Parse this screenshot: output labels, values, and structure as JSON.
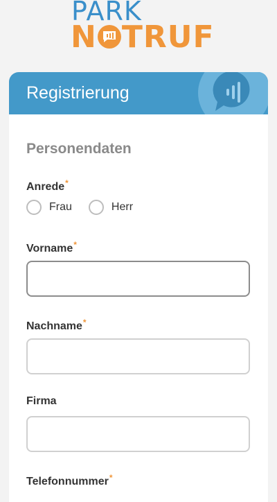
{
  "logo": {
    "line1": "PARK",
    "line2_start": "N",
    "line2_end": "TRUF"
  },
  "header": {
    "title": "Registrierung"
  },
  "section": {
    "title": "Personendaten"
  },
  "form": {
    "salutation": {
      "label": "Anrede",
      "required_mark": "*",
      "options": [
        "Frau",
        "Herr"
      ]
    },
    "first_name": {
      "label": "Vorname",
      "required_mark": "*",
      "value": ""
    },
    "last_name": {
      "label": "Nachname",
      "required_mark": "*",
      "value": ""
    },
    "company": {
      "label": "Firma",
      "value": ""
    },
    "phone": {
      "label": "Telefonnummer",
      "required_mark": "*"
    }
  },
  "colors": {
    "brand_blue": "#4399c9",
    "brand_orange": "#f0963a"
  }
}
